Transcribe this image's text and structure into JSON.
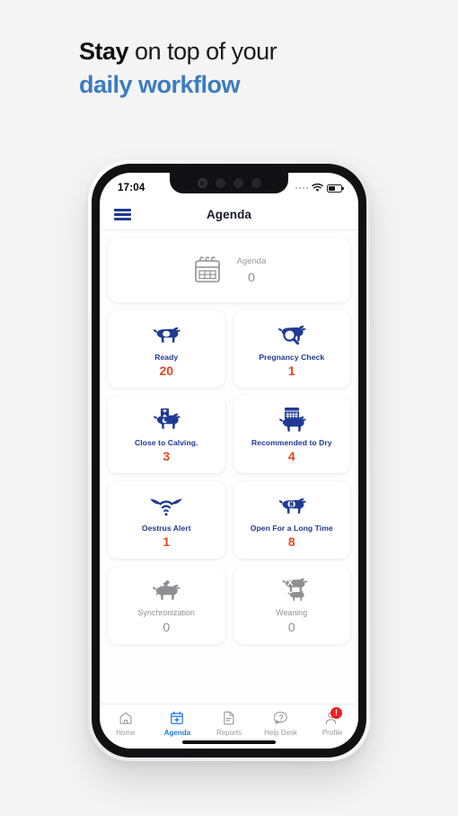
{
  "headline": {
    "line1_bold": "Stay",
    "line1_rest": " on top of your",
    "line2": "daily workflow"
  },
  "colors": {
    "navy": "#1f3a93",
    "orange": "#e8461d",
    "grey": "#8e8e93",
    "accent_blue": "#1f7ae0",
    "headline_blue": "#3b7cc0",
    "badge_red": "#ec2024"
  },
  "status_bar": {
    "time": "17:04",
    "signal_icon": "signal-dots-icon",
    "wifi_icon": "wifi-icon",
    "battery_icon": "battery-icon"
  },
  "header": {
    "menu_icon": "hamburger-menu-icon",
    "title": "Agenda"
  },
  "agenda_summary": {
    "icon": "calendar-icon",
    "label": "Agenda",
    "count": "0"
  },
  "tiles": [
    {
      "icon": "cow-icon",
      "label": "Ready",
      "count": "20",
      "state": "active"
    },
    {
      "icon": "cow-magnifier-icon",
      "label": "Pregnancy Check",
      "count": "1",
      "state": "active"
    },
    {
      "icon": "cow-hourglass-icon",
      "label": "Close to Calving.",
      "count": "3",
      "state": "active"
    },
    {
      "icon": "cow-calendar-icon",
      "label": "Recommended to Dry",
      "count": "4",
      "state": "active"
    },
    {
      "icon": "horns-signal-icon",
      "label": "Oestrus Alert",
      "count": "1",
      "state": "active"
    },
    {
      "icon": "cow-clock-icon",
      "label": "Open For a Long Time",
      "count": "8",
      "state": "active"
    },
    {
      "icon": "cow-syringe-icon",
      "label": "Synchronization",
      "count": "0",
      "state": "inactive"
    },
    {
      "icon": "cow-calf-icon",
      "label": "Weaning",
      "count": "0",
      "state": "inactive"
    }
  ],
  "bottom_nav": [
    {
      "icon": "home-icon",
      "label": "Home",
      "active": false,
      "badge": ""
    },
    {
      "icon": "calendar-plus-icon",
      "label": "Agenda",
      "active": true,
      "badge": ""
    },
    {
      "icon": "document-icon",
      "label": "Reports",
      "active": false,
      "badge": ""
    },
    {
      "icon": "question-chat-icon",
      "label": "Help Desk",
      "active": false,
      "badge": ""
    },
    {
      "icon": "person-icon",
      "label": "Profile",
      "active": false,
      "badge": "!"
    }
  ]
}
